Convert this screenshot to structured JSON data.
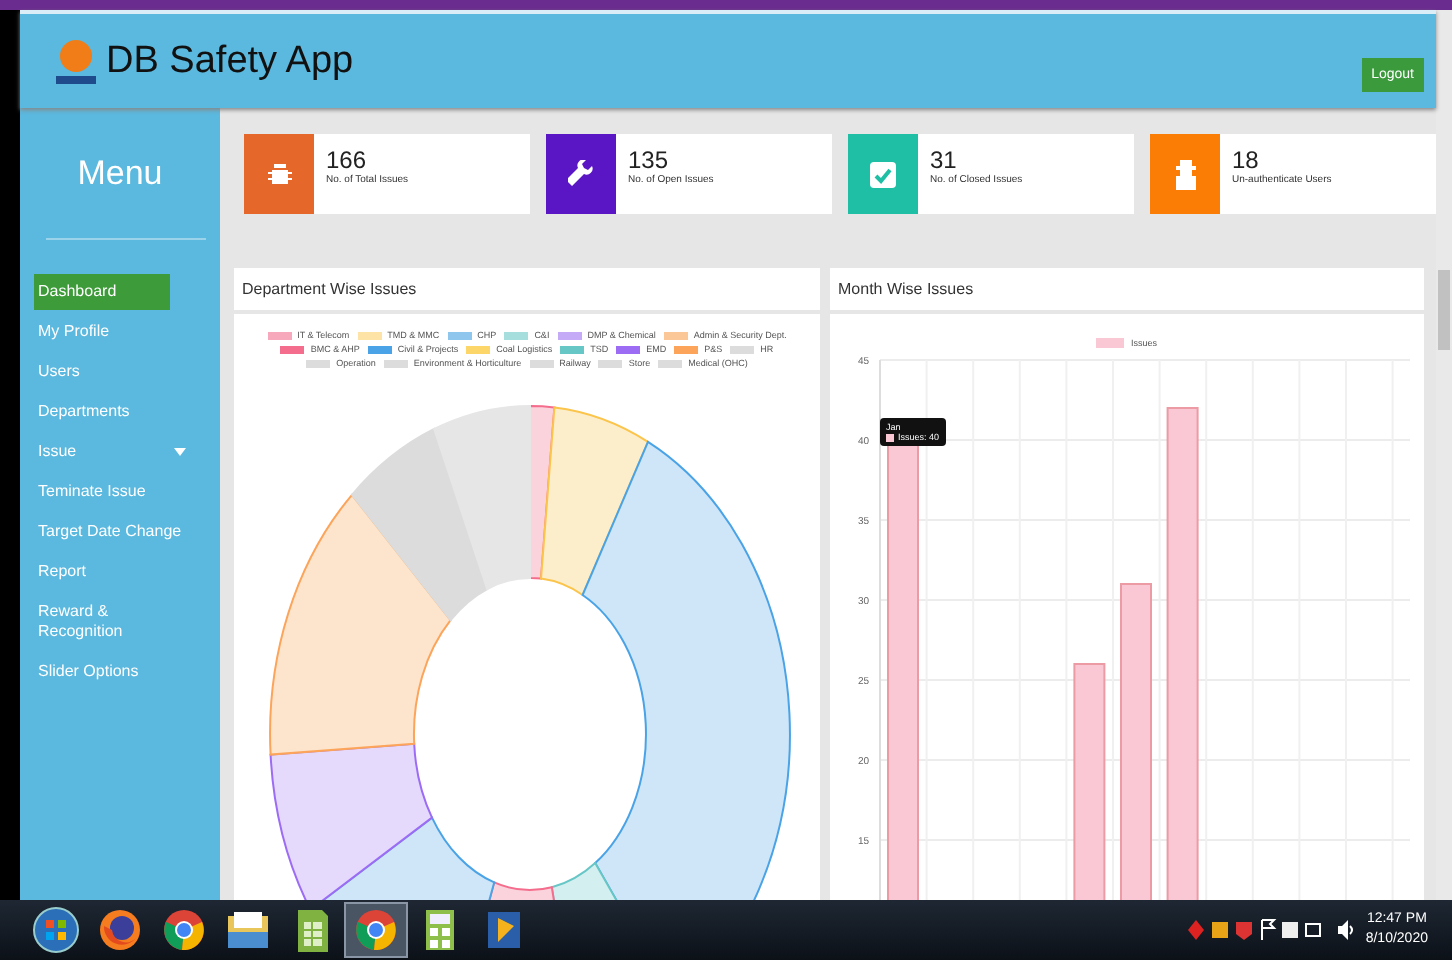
{
  "header": {
    "title": "DB Safety App",
    "logout": "Logout"
  },
  "sidebar": {
    "title": "Menu",
    "items": [
      {
        "label": "Dashboard",
        "selected": true,
        "kind": "link"
      },
      {
        "label": "My Profile",
        "selected": false,
        "kind": "link"
      },
      {
        "label": "Users",
        "selected": false,
        "kind": "link"
      },
      {
        "label": "Departments",
        "selected": false,
        "kind": "link"
      },
      {
        "label": "Issue",
        "selected": false,
        "kind": "submenu"
      },
      {
        "label": "Teminate Issue",
        "selected": false,
        "kind": "link"
      },
      {
        "label": "Target Date Change",
        "selected": false,
        "kind": "link"
      },
      {
        "label": "Report",
        "selected": false,
        "kind": "link"
      },
      {
        "label": "Reward & Recognition",
        "selected": false,
        "kind": "link"
      },
      {
        "label": "Slider Options",
        "selected": false,
        "kind": "link"
      }
    ]
  },
  "stats": [
    {
      "value": "166",
      "label": "No. of Total Issues",
      "color": "#e5672a",
      "kind": "bug"
    },
    {
      "value": "135",
      "label": "No. of Open Issues",
      "color": "#5a16c4",
      "kind": "wrench"
    },
    {
      "value": "31",
      "label": "No. of Closed Issues",
      "color": "#1fbfa5",
      "kind": "check"
    },
    {
      "value": "18",
      "label": "Un-authenticate Users",
      "color": "#fb7d05",
      "kind": "user"
    }
  ],
  "department_panel": {
    "title": "Department Wise Issues",
    "legend": [
      {
        "label": "IT & Telecom",
        "color": "#f7a9bb"
      },
      {
        "label": "TMD & MMC",
        "color": "#fde3a6"
      },
      {
        "label": "CHP",
        "color": "#8fc6ee"
      },
      {
        "label": "C&I",
        "color": "#a6dddd"
      },
      {
        "label": "DMP & Chemical",
        "color": "#c5aaf7"
      },
      {
        "label": "Admin & Security Dept.",
        "color": "#fcc796"
      },
      {
        "label": "BMC & AHP",
        "color": "#f46d8c"
      },
      {
        "label": "Civil & Projects",
        "color": "#4aa3e6"
      },
      {
        "label": "Coal Logistics",
        "color": "#fdd66a"
      },
      {
        "label": "TSD",
        "color": "#67c6c6"
      },
      {
        "label": "EMD",
        "color": "#9c6cf5"
      },
      {
        "label": "P&S",
        "color": "#fca45a"
      },
      {
        "label": "HR",
        "color": "#dcdcdc"
      },
      {
        "label": "Operation",
        "color": "#dcdcdc"
      },
      {
        "label": "Environment & Horticulture",
        "color": "#dcdcdc"
      },
      {
        "label": "Railway",
        "color": "#dcdcdc"
      },
      {
        "label": "Store",
        "color": "#dcdcdc"
      },
      {
        "label": "Medical (OHC)",
        "color": "#dcdcdc"
      }
    ]
  },
  "month_panel": {
    "title": "Month Wise Issues",
    "tooltip": {
      "title": "Jan",
      "label": "Issues: 40"
    },
    "chart_data": {
      "type": "bar",
      "ylim": [
        11,
        45
      ],
      "yticks": [
        15,
        20,
        25,
        30,
        35,
        40,
        45
      ],
      "grid": true,
      "series": [
        {
          "name": "Issues",
          "color": "#f9c8d4",
          "values": [
            40,
            null,
            null,
            null,
            26,
            31,
            42,
            null,
            null,
            null,
            null,
            null
          ]
        }
      ]
    }
  },
  "taskbar": {
    "items": [
      {
        "kind": "start",
        "selected": false
      },
      {
        "kind": "firefox",
        "selected": false
      },
      {
        "kind": "chrome",
        "selected": false
      },
      {
        "kind": "explorer",
        "selected": false
      },
      {
        "kind": "sheet",
        "selected": false
      },
      {
        "kind": "chrome",
        "selected": true
      },
      {
        "kind": "calc",
        "selected": false
      },
      {
        "kind": "app",
        "selected": false
      }
    ],
    "time": "12:47 PM",
    "date": "8/10/2020"
  }
}
